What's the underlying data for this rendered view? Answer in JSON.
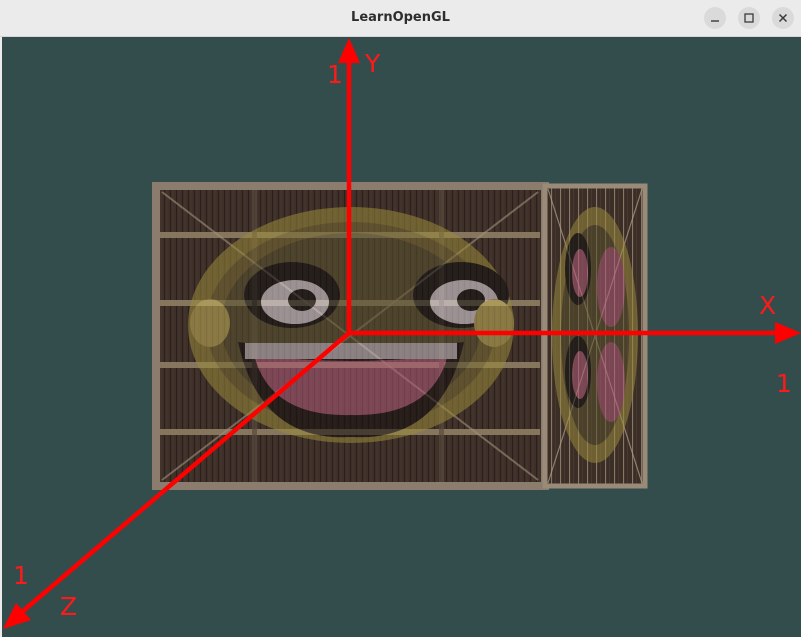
{
  "window": {
    "title": "LearnOpenGL",
    "controls": {
      "minimize": "minimize-icon",
      "maximize": "maximize-icon",
      "close": "close-icon"
    }
  },
  "scene": {
    "background_color": "#334d4d",
    "axis_color": "#ff0000",
    "axes": {
      "x": {
        "name": "X",
        "unit": "1"
      },
      "y": {
        "name": "Y",
        "unit": "1"
      },
      "z": {
        "name": "Z",
        "unit": "1"
      }
    },
    "quad": {
      "textures": [
        "wooden container",
        "awesome face"
      ]
    }
  }
}
